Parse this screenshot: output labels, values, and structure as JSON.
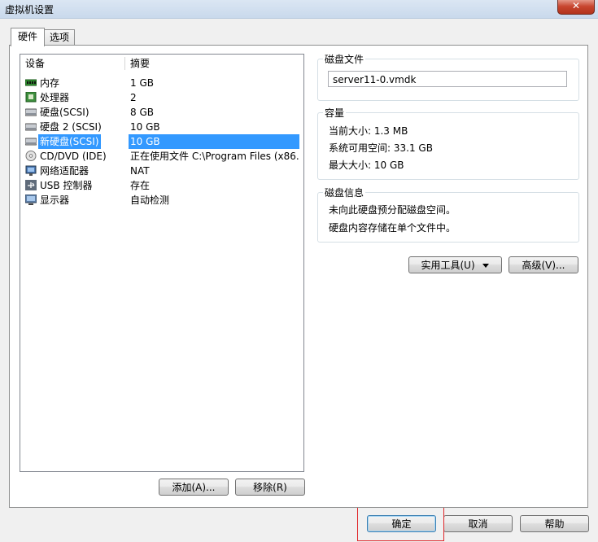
{
  "window": {
    "title": "虚拟机设置",
    "close_glyph": "✕"
  },
  "tabs": [
    {
      "label": "硬件"
    },
    {
      "label": "选项"
    }
  ],
  "device_list": {
    "headers": {
      "device": "设备",
      "summary": "摘要"
    },
    "rows": [
      {
        "name": "内存",
        "summary": "1 GB",
        "icon": "memory-icon"
      },
      {
        "name": "处理器",
        "summary": "2",
        "icon": "processor-icon"
      },
      {
        "name": "硬盘(SCSI)",
        "summary": "8 GB",
        "icon": "hard-disk-icon"
      },
      {
        "name": "硬盘 2 (SCSI)",
        "summary": "10 GB",
        "icon": "hard-disk-icon"
      },
      {
        "name": "新硬盘(SCSI)",
        "summary": "10 GB",
        "icon": "hard-disk-icon",
        "selected": true
      },
      {
        "name": "CD/DVD (IDE)",
        "summary": "正在使用文件 C:\\Program Files (x86...",
        "icon": "cd-dvd-icon"
      },
      {
        "name": "网络适配器",
        "summary": "NAT",
        "icon": "network-adapter-icon"
      },
      {
        "name": "USB 控制器",
        "summary": "存在",
        "icon": "usb-icon"
      },
      {
        "name": "显示器",
        "summary": "自动检测",
        "icon": "display-icon"
      }
    ]
  },
  "list_buttons": {
    "add": "添加(A)...",
    "remove": "移除(R)"
  },
  "disk_file": {
    "label": "磁盘文件",
    "value": "server11-0.vmdk"
  },
  "capacity": {
    "label": "容量",
    "current_size": "当前大小: 1.3 MB",
    "free_space": "系统可用空间: 33.1 GB",
    "max_size": "最大大小: 10 GB"
  },
  "disk_info": {
    "label": "磁盘信息",
    "line1": "未向此硬盘预分配磁盘空间。",
    "line2": "硬盘内容存储在单个文件中。"
  },
  "detail_buttons": {
    "utilities": "实用工具(U)",
    "advanced": "高级(V)..."
  },
  "dialog_buttons": {
    "ok": "确定",
    "cancel": "取消",
    "help": "帮助"
  },
  "colors": {
    "selection": "#3399ff",
    "highlight_box": "#e0262a"
  }
}
